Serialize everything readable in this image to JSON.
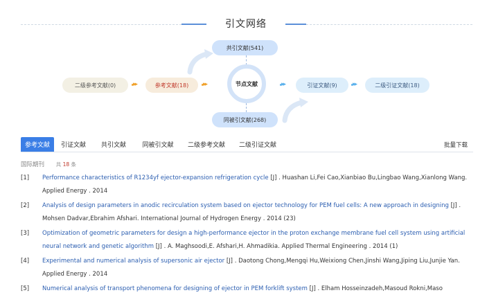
{
  "section": {
    "title": "引文网络"
  },
  "network": {
    "co_cited": "共引文献(541)",
    "co_citing": "同被引文献(268)",
    "secondary_references": "二级参考文献(0)",
    "references": "参考文献(18)",
    "node": "节点文献",
    "citations": "引证文献(9)",
    "secondary_citations": "二级引证文献(18)"
  },
  "tabs": [
    {
      "label": "参考文献",
      "active": true
    },
    {
      "label": "引证文献",
      "active": false
    },
    {
      "label": "共引文献",
      "active": false
    },
    {
      "label": "同被引文献",
      "active": false
    },
    {
      "label": "二级参考文献",
      "active": false
    },
    {
      "label": "二级引证文献",
      "active": false
    }
  ],
  "batch_download": "批量下载",
  "filter": {
    "category": "国际期刊",
    "count_prefix": "共",
    "count": "18",
    "count_suffix": "条"
  },
  "references": [
    {
      "index": "[1]",
      "title": "Performance characteristics of R1234yf ejector-expansion refrigeration cycle",
      "rest": " [J] . Huashan Li,Fei Cao,Xianbiao Bu,Lingbao Wang,Xianlong Wang.  Applied Energy . 2014"
    },
    {
      "index": "[2]",
      "title": "Analysis of design parameters in anodic recirculation system based on ejector technology for PEM fuel cells: A new approach in designing",
      "rest": " [J] . Mohsen Dadvar,Ebrahim Afshari.  International Journal of Hydrogen Energy . 2014 (23)"
    },
    {
      "index": "[3]",
      "title": "Optimization of geometric parameters for design a high-performance ejector in the proton exchange membrane fuel cell system using artificial neural network and genetic algorithm",
      "rest": " [J] . A. Maghsoodi,E. Afshari,H. Ahmadikia.  Applied Thermal Engineering . 2014 (1)"
    },
    {
      "index": "[4]",
      "title": "Experimental and numerical analysis of supersonic air ejector",
      "rest": " [J] . Daotong Chong,Mengqi Hu,Weixiong Chen,Jinshi Wang,Jiping Liu,Junjie Yan.  Applied Energy . 2014"
    },
    {
      "index": "[5]",
      "title": "Numerical analysis of transport phenomena for designing of ejector in PEM forklift system",
      "rest": " [J] . Elham Hosseinzadeh,Masoud Rokni,Maso"
    }
  ]
}
